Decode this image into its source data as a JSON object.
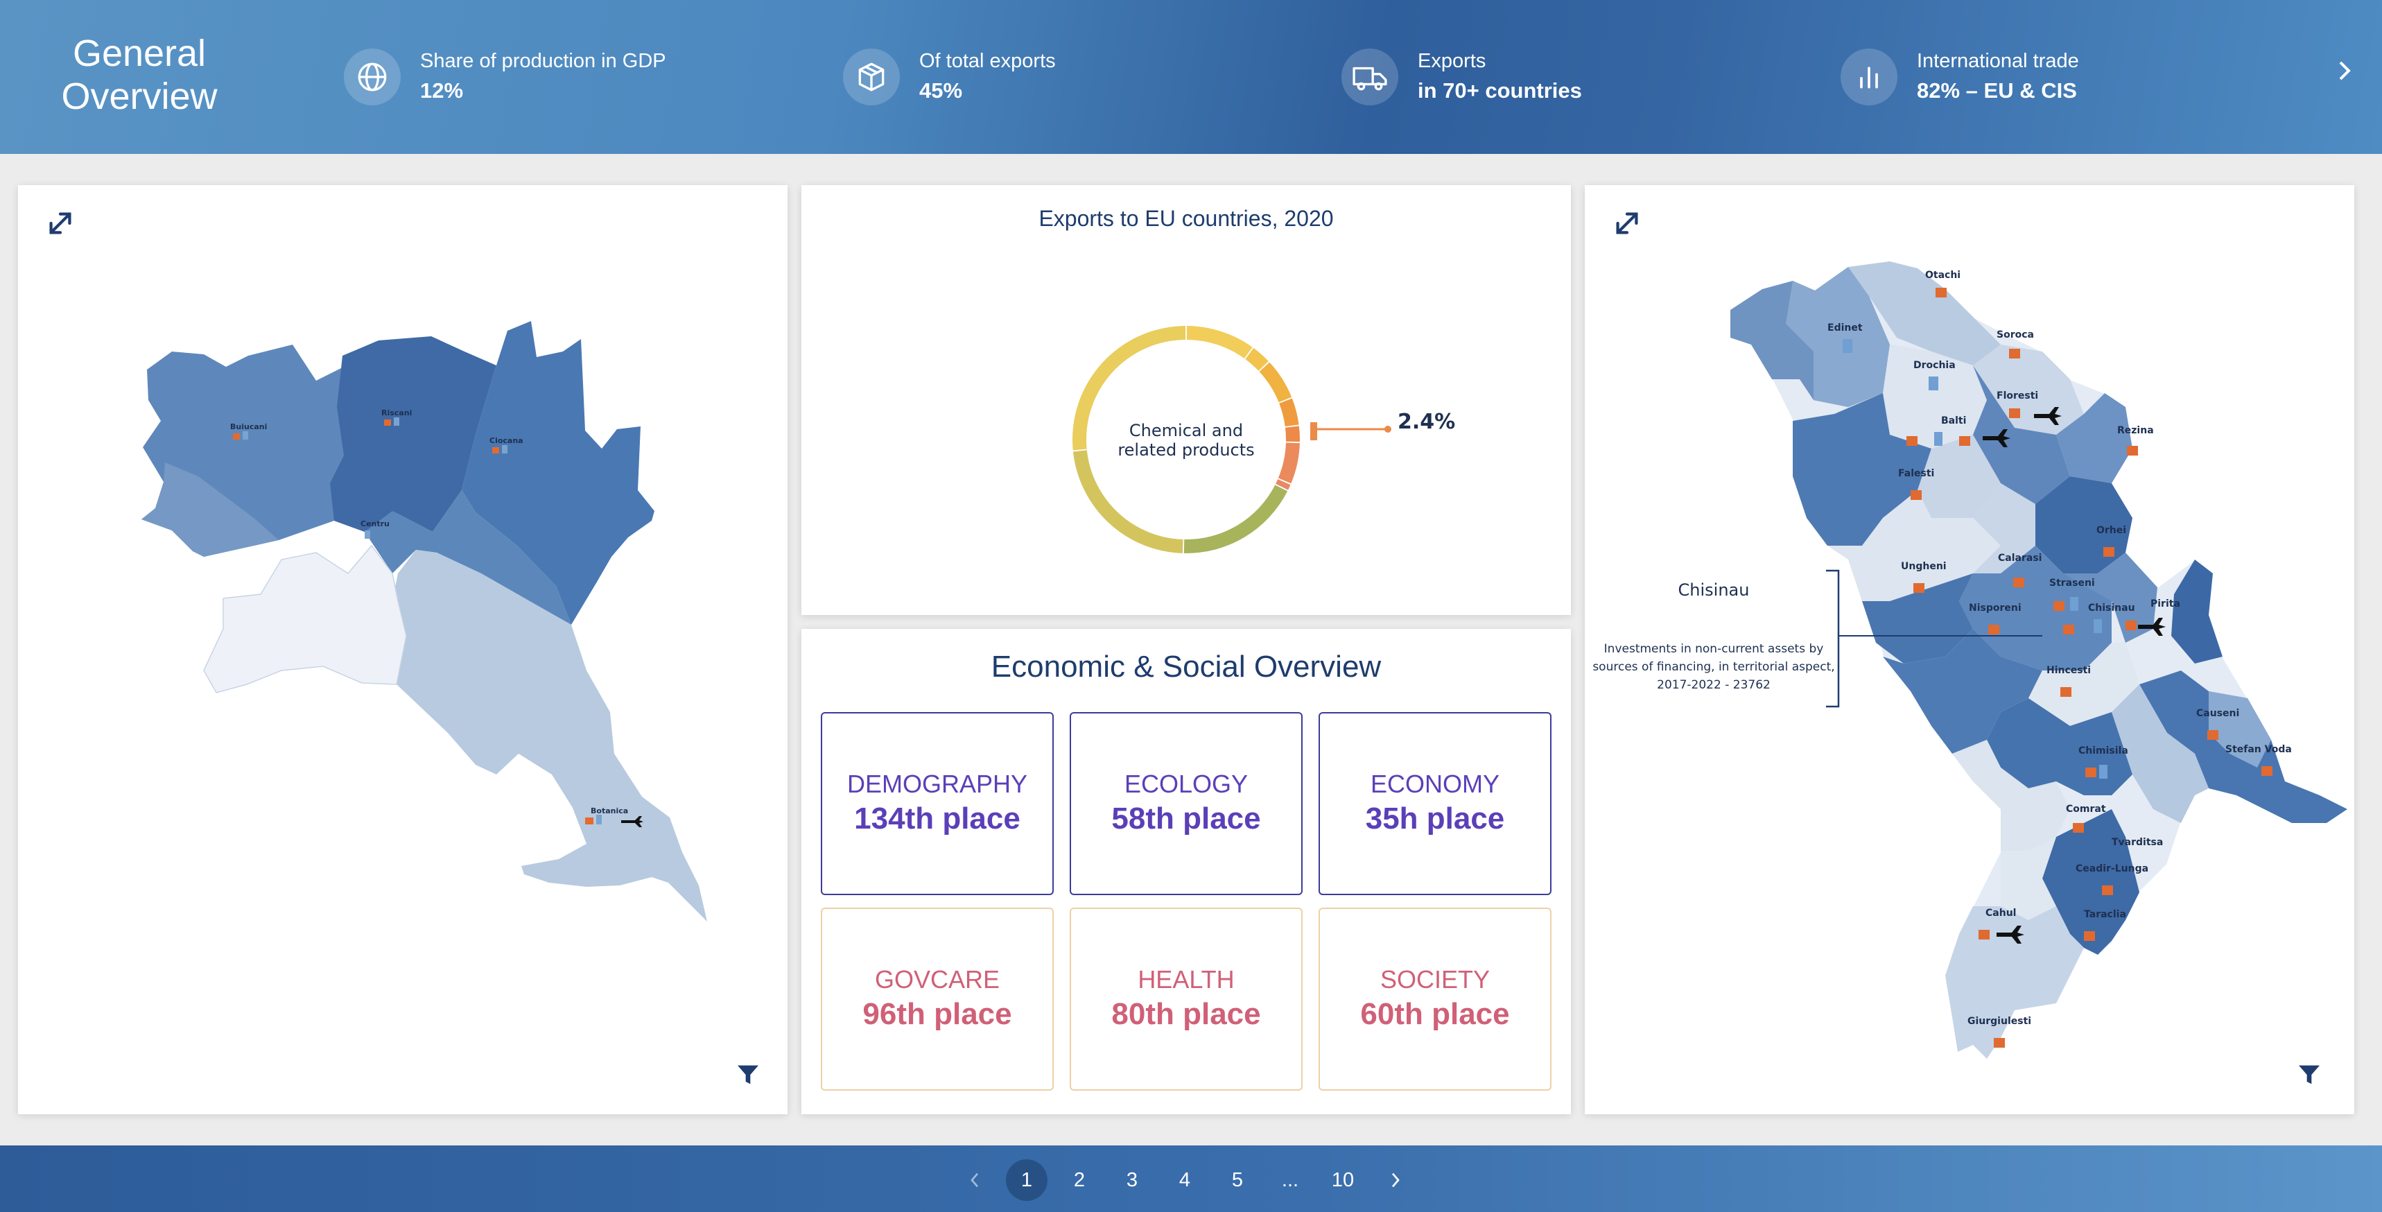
{
  "header": {
    "title": "General Overview",
    "stats": [
      {
        "icon": "globe-icon",
        "label": "Share of production in GDP",
        "value": "12%"
      },
      {
        "icon": "box-icon",
        "label": "Of total exports",
        "value": "45%"
      },
      {
        "icon": "truck-icon",
        "label": "Exports",
        "value": "in 70+ countries"
      },
      {
        "icon": "bar-chart-icon",
        "label": "International trade",
        "value": "82% – EU & CIS"
      }
    ],
    "next_icon": "chevron-right-icon"
  },
  "left_map": {
    "expand_icon": "expand-icon",
    "filter_icon": "filter-icon",
    "districts": [
      "Buiucani",
      "Riscani",
      "Ciocana",
      "Centru",
      "Botanica"
    ]
  },
  "donut": {
    "title": "Exports to EU countries, 2020",
    "center_label_line1": "Chemical and",
    "center_label_line2": "related products",
    "highlight_value": "2.4%",
    "chart_data": {
      "type": "pie",
      "title": "Exports to EU countries, 2020",
      "highlighted_category": "Chemical and related products",
      "highlighted_share_percent": 2.4,
      "slice_colors": [
        "#f2cd5a",
        "#f2c44e",
        "#f0b240",
        "#ee9c3f",
        "#ec8a4a",
        "#eb8a5c",
        "#e58a67",
        "#a7b45b",
        "#d4c45e",
        "#e9cd5d"
      ],
      "approx_slice_percents": [
        10,
        3,
        6,
        4,
        2.4,
        6,
        1,
        18,
        23,
        26.6
      ]
    }
  },
  "overview": {
    "title": "Economic & Social Overview",
    "cards": [
      {
        "name": "DEMOGRAPHY",
        "rank": "134th place",
        "color": "blue"
      },
      {
        "name": "ECOLOGY",
        "rank": "58th place",
        "color": "blue"
      },
      {
        "name": "ECONOMY",
        "rank": "35h place",
        "color": "blue"
      },
      {
        "name": "GOVCARE",
        "rank": "96th place",
        "color": "pink"
      },
      {
        "name": "HEALTH",
        "rank": "80th place",
        "color": "pink"
      },
      {
        "name": "SOCIETY",
        "rank": "60th place",
        "color": "pink"
      }
    ]
  },
  "right_map": {
    "expand_icon": "expand-icon",
    "filter_icon": "filter-icon",
    "callout_title": "Chisinau",
    "callout_text_line1": "Investments in non-current assets by",
    "callout_text_line2": "sources of financing, in territorial aspect,",
    "callout_text_line3": "2017-2022 - 23762",
    "districts": [
      "Otachi",
      "Edinet",
      "Soroca",
      "Drochia",
      "Floresti",
      "Balti",
      "Rezina",
      "Falesti",
      "Orhei",
      "Ungheni",
      "Calarasi",
      "Straseni",
      "Nisporeni",
      "Chisinau",
      "Pirita",
      "Hincesti",
      "Causeni",
      "Stefan Voda",
      "Chimisila",
      "Comrat",
      "Tvarditsa",
      "Ceadir-Lunga",
      "Taraclia",
      "Cahul",
      "Giurgiulesti"
    ]
  },
  "pagination": {
    "prev_icon": "chevron-left-icon",
    "pages": [
      "1",
      "2",
      "3",
      "4",
      "5",
      "...",
      "10"
    ],
    "active_page": "1",
    "next_icon": "chevron-right-icon"
  }
}
